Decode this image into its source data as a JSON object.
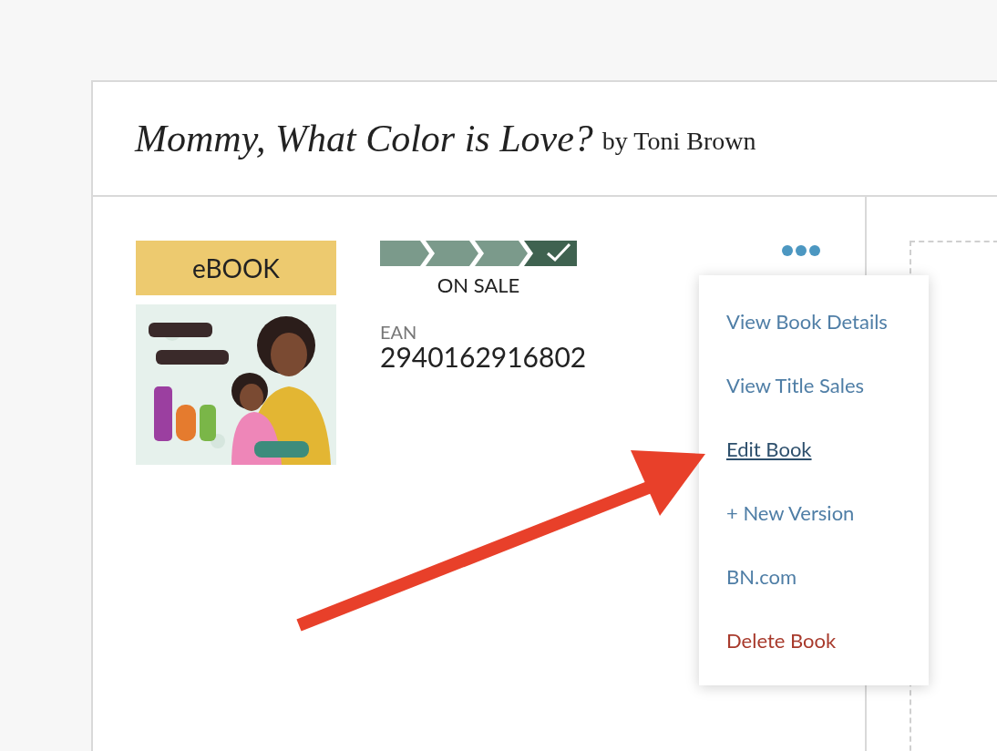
{
  "book": {
    "title": "Mommy, What Color is Love?",
    "byline": "by Toni Brown",
    "format": "eBOOK",
    "progress": {
      "stages": [
        {
          "current": false
        },
        {
          "current": false
        },
        {
          "current": false
        },
        {
          "current": true
        }
      ],
      "status": "ON SALE"
    },
    "ean_label": "EAN",
    "ean": "2940162916802"
  },
  "menu": {
    "items": [
      {
        "label": "View Book Details",
        "kind": "link",
        "hovered": false
      },
      {
        "label": "View Title Sales",
        "kind": "link",
        "hovered": false
      },
      {
        "label": "Edit Book",
        "kind": "link",
        "hovered": true
      },
      {
        "label": "+ New Version",
        "kind": "link",
        "hovered": false
      },
      {
        "label": "BN.com",
        "kind": "link",
        "hovered": false
      },
      {
        "label": "Delete Book",
        "kind": "danger",
        "hovered": false
      }
    ]
  },
  "annotation": {
    "kind": "arrow"
  }
}
